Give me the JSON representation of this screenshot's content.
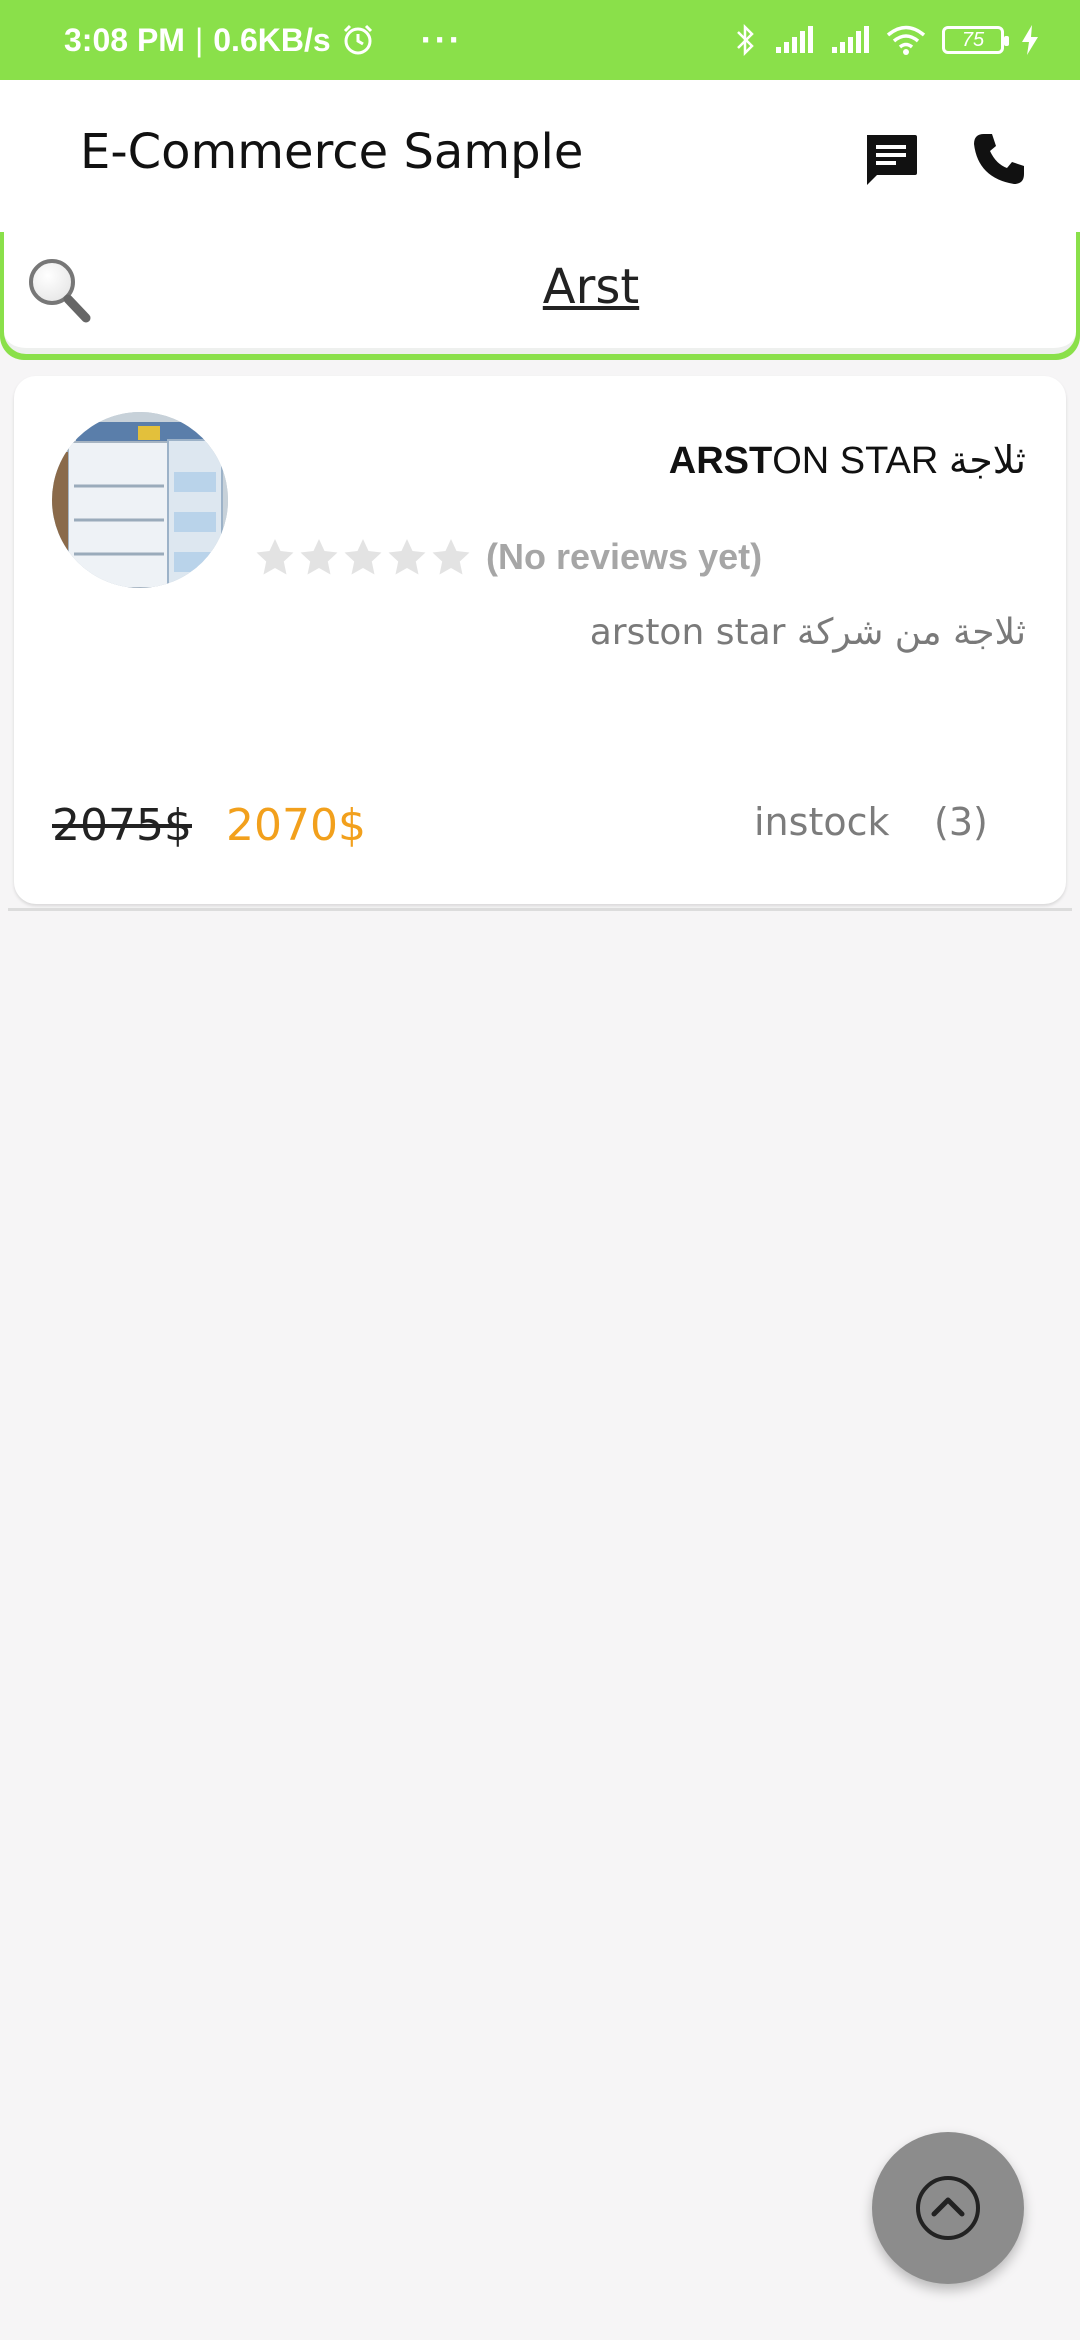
{
  "status_bar": {
    "time": "3:08 PM",
    "separator": "|",
    "speed": "0.6KB/s",
    "dots": "···",
    "battery": "75",
    "icons": [
      "alarm-icon",
      "bluetooth-icon",
      "signal-icon",
      "signal-icon",
      "wifi-icon",
      "battery-icon",
      "charging-icon"
    ]
  },
  "app_bar": {
    "title": "E-Commerce Sample",
    "actions": [
      "chat-icon",
      "phone-icon"
    ],
    "color": "#8ae04a"
  },
  "search": {
    "value": "Arst",
    "icon": "search-icon"
  },
  "products": [
    {
      "title_bold": "ARST",
      "title_rest": "ON STAR ثلاجة",
      "rating": 0,
      "reviews_text": "(No reviews yet)",
      "description": "ثلاجة من شركة arston star",
      "old_price": "2075$",
      "new_price": "2070$",
      "stock_label": "instock",
      "stock_count": "(3)",
      "price_color": "#f2a01c"
    }
  ],
  "fab": {
    "icon": "chevron-up-icon"
  }
}
